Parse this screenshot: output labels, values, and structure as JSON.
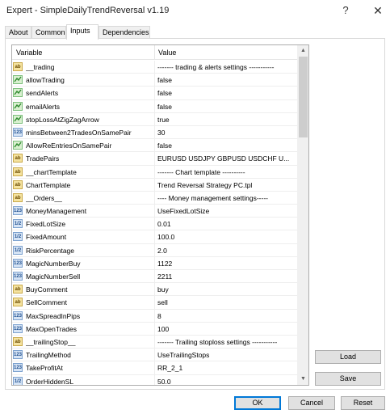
{
  "window": {
    "title": "Expert - SimpleDailyTrendReversal v1.19",
    "help_glyph": "?",
    "close_glyph": "✕"
  },
  "tabs": [
    "About",
    "Common",
    "Inputs",
    "Dependencies"
  ],
  "active_tab": "Inputs",
  "grid": {
    "col_variable": "Variable",
    "col_value": "Value",
    "rows": [
      {
        "type": "string",
        "icon": "ab",
        "name": "__trading",
        "value": "------- trading & alerts settings -----------"
      },
      {
        "type": "bool",
        "icon": "bool",
        "name": "allowTrading",
        "value": "false"
      },
      {
        "type": "bool",
        "icon": "bool",
        "name": "sendAlerts",
        "value": "false"
      },
      {
        "type": "bool",
        "icon": "bool",
        "name": "emailAlerts",
        "value": "false"
      },
      {
        "type": "bool",
        "icon": "bool",
        "name": "stopLossAtZigZagArrow",
        "value": "true"
      },
      {
        "type": "int",
        "icon": "123",
        "name": "minsBetween2TradesOnSamePair",
        "value": "30"
      },
      {
        "type": "bool",
        "icon": "bool",
        "name": "AllowReEntriesOnSamePair",
        "value": "false"
      },
      {
        "type": "string",
        "icon": "ab",
        "name": "TradePairs",
        "value": "EURUSD USDJPY GBPUSD USDCHF U..."
      },
      {
        "type": "string",
        "icon": "ab",
        "name": "__chartTemplate",
        "value": "------- Chart template ----------"
      },
      {
        "type": "string",
        "icon": "ab",
        "name": "ChartTemplate",
        "value": "Trend Reversal Strategy PC.tpl"
      },
      {
        "type": "string",
        "icon": "ab",
        "name": "__Orders__",
        "value": "---- Money management settings-----"
      },
      {
        "type": "int",
        "icon": "123",
        "name": "MoneyManagement",
        "value": "UseFixedLotSize"
      },
      {
        "type": "double",
        "icon": "1/2",
        "name": "FixedLotSize",
        "value": "0.01"
      },
      {
        "type": "double",
        "icon": "1/2",
        "name": "FixedAmount",
        "value": "100.0"
      },
      {
        "type": "double",
        "icon": "1/2",
        "name": "RiskPercentage",
        "value": "2.0"
      },
      {
        "type": "int",
        "icon": "123",
        "name": "MagicNumberBuy",
        "value": "1122"
      },
      {
        "type": "int",
        "icon": "123",
        "name": "MagicNumberSell",
        "value": "2211"
      },
      {
        "type": "string",
        "icon": "ab",
        "name": "BuyComment",
        "value": "buy"
      },
      {
        "type": "string",
        "icon": "ab",
        "name": "SellComment",
        "value": "sell"
      },
      {
        "type": "int",
        "icon": "123",
        "name": "MaxSpreadInPips",
        "value": "8"
      },
      {
        "type": "int",
        "icon": "123",
        "name": "MaxOpenTrades",
        "value": "100"
      },
      {
        "type": "string",
        "icon": "ab",
        "name": "__trailingStop__",
        "value": "------- Trailing stoploss settings -----------"
      },
      {
        "type": "int",
        "icon": "123",
        "name": "TrailingMethod",
        "value": "UseTrailingStops"
      },
      {
        "type": "int",
        "icon": "123",
        "name": "TakeProfitAt",
        "value": "RR_2_1"
      },
      {
        "type": "double",
        "icon": "1/2",
        "name": "OrderHiddenSL",
        "value": "50.0"
      }
    ]
  },
  "scrollbar": {
    "up_glyph": "▲",
    "down_glyph": "▼"
  },
  "buttons": {
    "load": "Load",
    "save": "Save",
    "ok": "OK",
    "cancel": "Cancel",
    "reset": "Reset"
  }
}
